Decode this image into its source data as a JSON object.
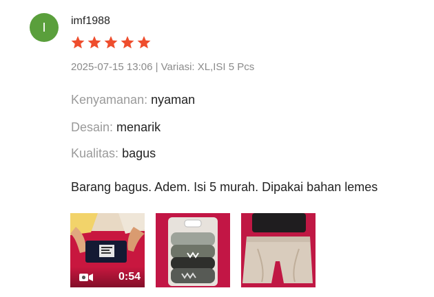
{
  "review": {
    "avatar_initial": "I",
    "username": "imf1988",
    "rating": 5,
    "max_rating": 5,
    "meta": "2025-07-15 13:06 | Variasi: XL,ISI 5 Pcs",
    "attributes": [
      {
        "label": "Kenyamanan:",
        "value": "nyaman"
      },
      {
        "label": "Desain:",
        "value": "menarik"
      },
      {
        "label": "Kualitas:",
        "value": "bagus"
      }
    ],
    "comment": "Barang bagus. Adem. Isi 5 murah. Dipakai bahan lemes",
    "media": [
      {
        "type": "video",
        "duration": "0:54",
        "icon": "video-camera-icon"
      },
      {
        "type": "image"
      },
      {
        "type": "image"
      }
    ]
  },
  "colors": {
    "avatar_bg": "#5a9f3c",
    "star": "#ee4d2d",
    "label": "#9a9a9a",
    "meta": "#8a8a8a",
    "text": "#222222"
  }
}
